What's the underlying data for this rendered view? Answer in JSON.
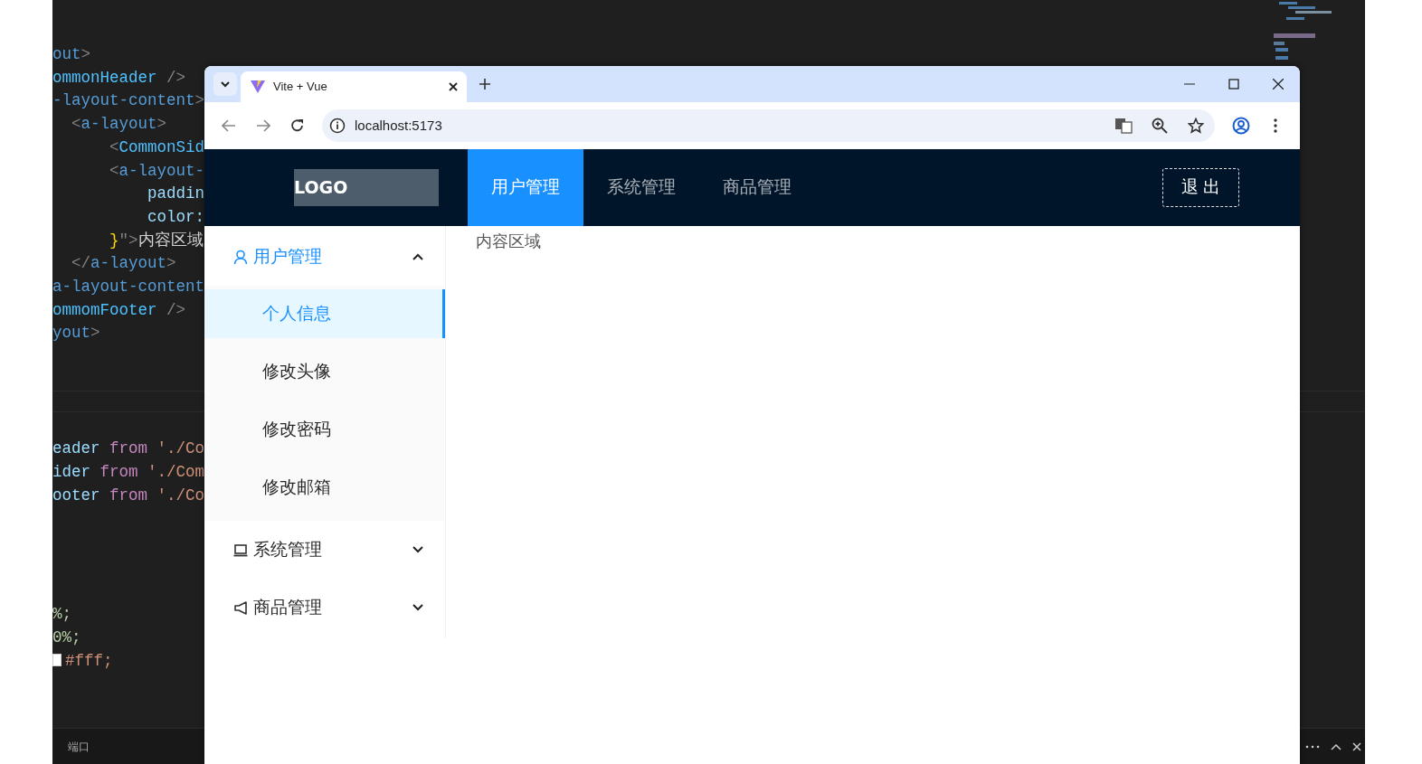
{
  "editor": {
    "code_lines": [
      {
        "segments": [
          {
            "text": "out",
            "kind": "tag"
          },
          {
            "text": ">",
            "kind": "punct"
          }
        ]
      },
      {
        "segments": [
          {
            "text": "ommonHeader",
            "kind": "component"
          },
          {
            "text": " />",
            "kind": "punct"
          }
        ]
      },
      {
        "segments": [
          {
            "text": "-layout-content",
            "kind": "tag"
          },
          {
            "text": ">",
            "kind": "punct"
          }
        ]
      },
      {
        "segments": [
          {
            "text": "  <",
            "kind": "punct"
          },
          {
            "text": "a-layout",
            "kind": "tag"
          },
          {
            "text": ">",
            "kind": "punct"
          }
        ]
      },
      {
        "segments": [
          {
            "text": "      <",
            "kind": "punct"
          },
          {
            "text": "CommonSid",
            "kind": "component"
          }
        ]
      },
      {
        "segments": [
          {
            "text": "      <",
            "kind": "punct"
          },
          {
            "text": "a-layout-",
            "kind": "tag"
          }
        ]
      },
      {
        "segments": [
          {
            "text": "          paddin",
            "kind": "attr"
          }
        ]
      },
      {
        "segments": [
          {
            "text": "          color:",
            "kind": "attr"
          }
        ]
      },
      {
        "segments": [
          {
            "text": "      }",
            "kind": "brace"
          },
          {
            "text": "\">",
            "kind": "punct"
          },
          {
            "text": "内容区域",
            "kind": "plain"
          }
        ]
      },
      {
        "segments": [
          {
            "text": "  </",
            "kind": "punct"
          },
          {
            "text": "a-layout",
            "kind": "tag"
          },
          {
            "text": ">",
            "kind": "punct"
          }
        ]
      },
      {
        "segments": [
          {
            "text": "a-layout-content",
            "kind": "tag"
          }
        ]
      },
      {
        "segments": [
          {
            "text": "ommomFooter",
            "kind": "component"
          },
          {
            "text": " />",
            "kind": "punct"
          }
        ]
      },
      {
        "segments": [
          {
            "text": "yout",
            "kind": "tag"
          },
          {
            "text": ">",
            "kind": "punct"
          }
        ]
      }
    ],
    "import_lines": [
      {
        "segments": [
          {
            "text": "eader",
            "kind": "attr"
          },
          {
            "text": " from ",
            "kind": "keyword"
          },
          {
            "text": "'./Co",
            "kind": "string"
          }
        ]
      },
      {
        "segments": [
          {
            "text": "ider",
            "kind": "attr"
          },
          {
            "text": " from ",
            "kind": "keyword"
          },
          {
            "text": "'./Com",
            "kind": "string"
          }
        ]
      },
      {
        "segments": [
          {
            "text": "ooter",
            "kind": "attr"
          },
          {
            "text": " from ",
            "kind": "keyword"
          },
          {
            "text": "'./Co",
            "kind": "string"
          }
        ]
      }
    ],
    "style_lines": [
      {
        "segments": [
          {
            "text": "%;",
            "kind": "number"
          }
        ]
      },
      {
        "segments": [
          {
            "text": "0%;",
            "kind": "number"
          }
        ]
      },
      {
        "kind": "color",
        "segments": [
          {
            "text": "#fff;",
            "kind": "string"
          }
        ]
      }
    ],
    "status_bar": {
      "panel_label": "端口"
    }
  },
  "browser": {
    "tab": {
      "title": "Vite + Vue"
    },
    "address": "localhost:5173",
    "app": {
      "logo": "LOGO",
      "nav": [
        {
          "label": "用户管理",
          "selected": true
        },
        {
          "label": "系统管理",
          "selected": false
        },
        {
          "label": "商品管理",
          "selected": false
        }
      ],
      "logout": "退 出",
      "sidebar": [
        {
          "label": "用户管理",
          "kind": "user",
          "expanded": true,
          "children": [
            {
              "label": "个人信息",
              "selected": true
            },
            {
              "label": "修改头像",
              "selected": false
            },
            {
              "label": "修改密码",
              "selected": false
            },
            {
              "label": "修改邮箱",
              "selected": false
            }
          ]
        },
        {
          "label": "系统管理",
          "kind": "laptop",
          "expanded": false
        },
        {
          "label": "商品管理",
          "kind": "notification",
          "expanded": false
        }
      ],
      "content": "内容区域"
    }
  }
}
